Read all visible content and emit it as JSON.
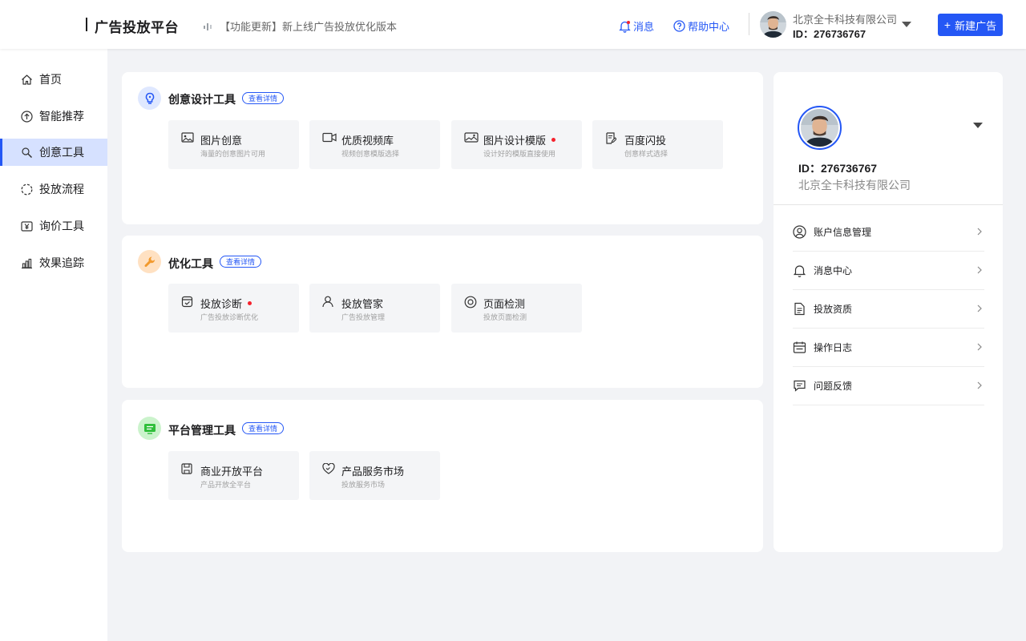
{
  "header": {
    "brand": "广告投放平台",
    "announcement": "【功能更新】新上线广告投放优化版本",
    "messages_label": "消息",
    "help_label": "帮助中心",
    "company": "北京全卡科技有限公司",
    "user_id": "ID：276736767",
    "new_ad_label": "新建广告",
    "new_ad_plus": "+"
  },
  "sidebar": {
    "items": [
      {
        "label": "首页",
        "icon": "home-icon"
      },
      {
        "label": "智能推荐",
        "icon": "arrow-up-circle-icon"
      },
      {
        "label": "创意工具",
        "icon": "wrench-icon",
        "active": true
      },
      {
        "label": "投放流程",
        "icon": "dashed-circle-icon"
      },
      {
        "label": "询价工具",
        "icon": "yuan-icon"
      },
      {
        "label": "效果追踪",
        "icon": "bar-chart-icon"
      }
    ]
  },
  "sections": [
    {
      "title": "创意设计工具",
      "detail": "查看详情",
      "icon": "lightbulb-icon",
      "tiles": [
        {
          "title": "图片创意",
          "sub": "海量的创意图片可用",
          "icon": "image-icon"
        },
        {
          "title": "优质视频库",
          "sub": "视频创意模版选择",
          "icon": "video-icon"
        },
        {
          "title": "图片设计模版",
          "sub": "设计好的模版直接使用",
          "icon": "image-template-icon",
          "dot": true
        },
        {
          "title": "百度闪投",
          "sub": "创意样式选择",
          "icon": "document-edit-icon"
        }
      ]
    },
    {
      "title": "优化工具",
      "detail": "查看详情",
      "icon": "wrench-icon",
      "tiles": [
        {
          "title": "投放诊断",
          "sub": "广告投放诊断优化",
          "icon": "diagnosis-icon",
          "dot": true
        },
        {
          "title": "投放管家",
          "sub": "广告投放管理",
          "icon": "user-icon"
        },
        {
          "title": "页面检测",
          "sub": "投放页面检测",
          "icon": "target-icon"
        }
      ]
    },
    {
      "title": "平台管理工具",
      "detail": "查看详情",
      "icon": "monitor-icon",
      "tiles": [
        {
          "title": "商业开放平台",
          "sub": "产品开放全平台",
          "icon": "save-icon"
        },
        {
          "title": "产品服务市场",
          "sub": "投放服务市场",
          "icon": "heart-icon"
        }
      ]
    }
  ],
  "profile": {
    "user_id": "ID：276736767",
    "company": "北京全卡科技有限公司",
    "menu": [
      {
        "label": "账户信息管理",
        "icon": "user-circle-icon"
      },
      {
        "label": "消息中心",
        "icon": "bell-icon"
      },
      {
        "label": "投放资质",
        "icon": "file-icon"
      },
      {
        "label": "操作日志",
        "icon": "calendar-icon"
      },
      {
        "label": "问题反馈",
        "icon": "feedback-icon"
      }
    ]
  },
  "colors": {
    "accent": "#2457f5",
    "active_bg": "#d6e1ff",
    "dot": "#f5222d",
    "section_icon_bgs": [
      "#dfe8ff",
      "#ffe1c2",
      "#cbf3cc"
    ]
  }
}
